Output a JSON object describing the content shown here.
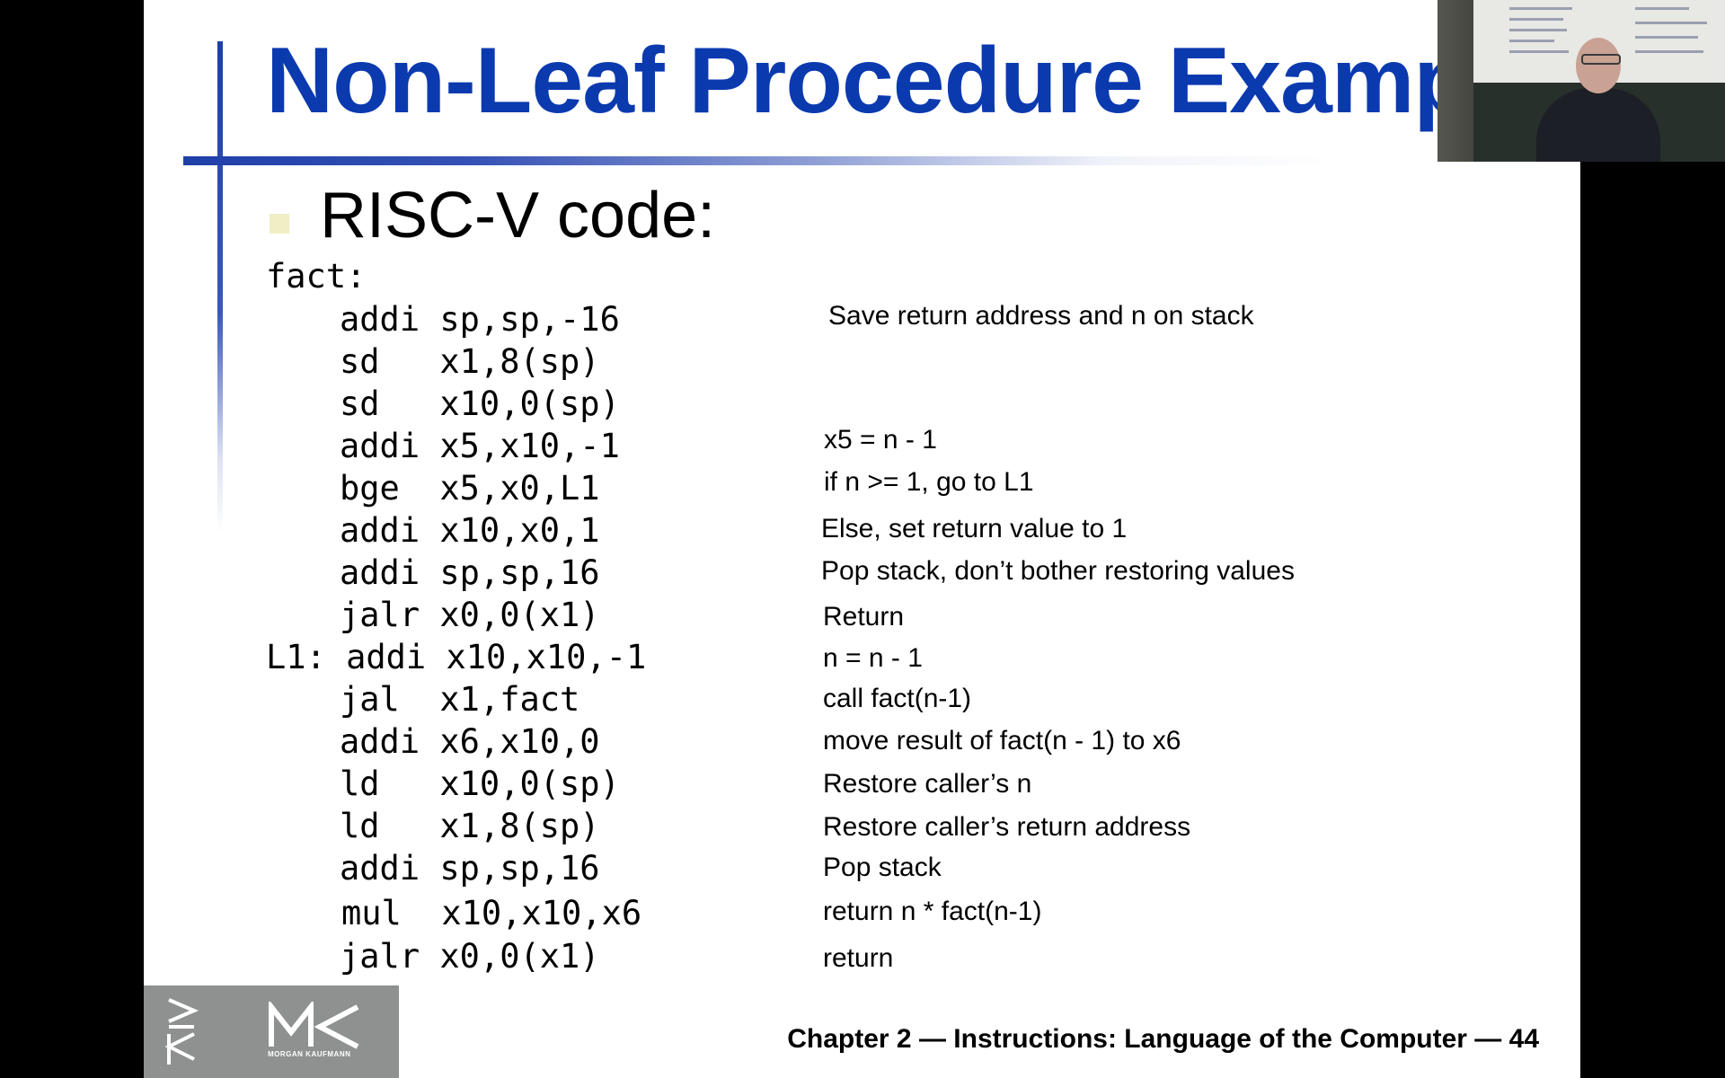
{
  "slide": {
    "title": "Non-Leaf Procedure Exampl",
    "bullet": "RISC-V code:",
    "label": "fact:",
    "code_lines": [
      {
        "label": "",
        "code": "addi sp,sp,-16",
        "comment": "Save return address and n on stack"
      },
      {
        "label": "",
        "code": "sd   x1,8(sp)",
        "comment": ""
      },
      {
        "label": "",
        "code": "sd   x10,0(sp)",
        "comment": ""
      },
      {
        "label": "",
        "code": "addi x5,x10,-1",
        "comment": "x5 = n - 1"
      },
      {
        "label": "",
        "code": "bge  x5,x0,L1",
        "comment": "if n >= 1, go to L1"
      },
      {
        "label": "",
        "code": "addi x10,x0,1",
        "comment": "Else, set return value to 1"
      },
      {
        "label": "",
        "code": "addi sp,sp,16",
        "comment": "Pop stack, don’t bother restoring values"
      },
      {
        "label": "",
        "code": "jalr x0,0(x1)",
        "comment": "Return"
      },
      {
        "label": "L1: ",
        "code": "addi x10,x10,-1",
        "comment": "n = n - 1"
      },
      {
        "label": "",
        "code": "jal  x1,fact",
        "comment": "call fact(n-1)"
      },
      {
        "label": "",
        "code": "addi x6,x10,0",
        "comment": "move result of fact(n - 1) to x6"
      },
      {
        "label": "",
        "code": "ld   x10,0(sp)",
        "comment": "Restore caller’s n"
      },
      {
        "label": "",
        "code": "ld   x1,8(sp)",
        "comment": "Restore caller’s return address"
      },
      {
        "label": "",
        "code": "addi sp,sp,16",
        "comment": "Pop stack"
      },
      {
        "label": "",
        "code": "mul  x10,x10,x6",
        "comment": "return n * fact(n-1)"
      },
      {
        "label": "",
        "code": "jalr x0,0(x1)",
        "comment": "return"
      }
    ],
    "footer": "Chapter 2 — Instructions: Language of the Computer — 44",
    "logo": {
      "mark": "MK",
      "publisher": "MORGAN KAUFMANN"
    }
  },
  "colors": {
    "title": "#0b3aaf",
    "bullet": "#f0eec4",
    "logo_bg": "#8e918f",
    "background": "#000000"
  },
  "webcam": {
    "icon": "presenter-video"
  }
}
